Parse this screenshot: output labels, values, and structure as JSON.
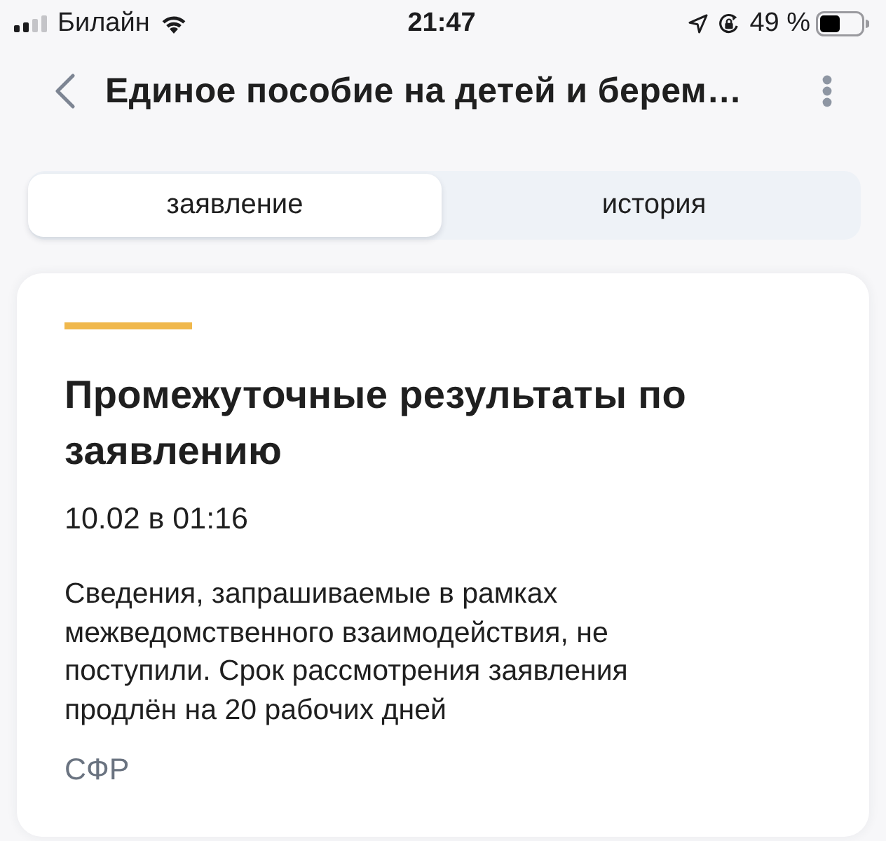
{
  "status_bar": {
    "carrier": "Билайн",
    "time": "21:47",
    "battery_percent": "49 %"
  },
  "nav": {
    "title": "Единое пособие на детей и берем…"
  },
  "tabs": [
    {
      "label": "заявление",
      "selected": true
    },
    {
      "label": "история",
      "selected": false
    }
  ],
  "card": {
    "title": "Промежуточные результаты по заявлению",
    "date": "10.02 в 01:16",
    "message": "Сведения, запрашиваемые в рамках межведомственного взаимодействия, не поступили. Срок рассмотрения заявления продлён на 20 рабочих дней",
    "source": "СФР"
  }
}
